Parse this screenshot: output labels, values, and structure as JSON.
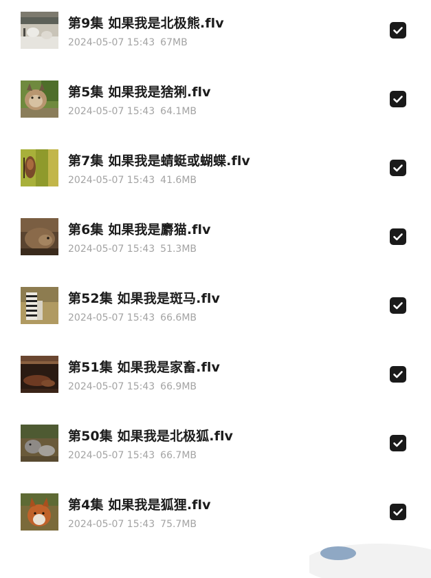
{
  "files": [
    {
      "name": "第9集 如果我是北极熊.flv",
      "date": "2024-05-07 15:43",
      "size": "67MB",
      "thumb_icon": "polar-bear-thumbnail",
      "checked": true
    },
    {
      "name": "第5集 如果我是猞猁.flv",
      "date": "2024-05-07 15:43",
      "size": "64.1MB",
      "thumb_icon": "lynx-thumbnail",
      "checked": true
    },
    {
      "name": "第7集 如果我是蜻蜓或蝴蝶.flv",
      "date": "2024-05-07 15:43",
      "size": "41.6MB",
      "thumb_icon": "dragonfly-butterfly-thumbnail",
      "checked": true
    },
    {
      "name": "第6集 如果我是麝猫.flv",
      "date": "2024-05-07 15:43",
      "size": "51.3MB",
      "thumb_icon": "civet-thumbnail",
      "checked": true
    },
    {
      "name": "第52集 如果我是斑马.flv",
      "date": "2024-05-07 15:43",
      "size": "66.6MB",
      "thumb_icon": "zebra-thumbnail",
      "checked": true
    },
    {
      "name": "第51集 如果我是家畜.flv",
      "date": "2024-05-07 15:43",
      "size": "66.9MB",
      "thumb_icon": "livestock-thumbnail",
      "checked": true
    },
    {
      "name": "第50集 如果我是北极狐.flv",
      "date": "2024-05-07 15:43",
      "size": "66.7MB",
      "thumb_icon": "arctic-fox-thumbnail",
      "checked": true
    },
    {
      "name": "第4集 如果我是狐狸.flv",
      "date": "2024-05-07 15:43",
      "size": "75.7MB",
      "thumb_icon": "fox-thumbnail",
      "checked": true
    }
  ],
  "colors": {
    "filename": "#1c1c1c",
    "meta": "#a3a3a3",
    "checkbox": "#1a1a1a",
    "background": "#ffffff"
  }
}
